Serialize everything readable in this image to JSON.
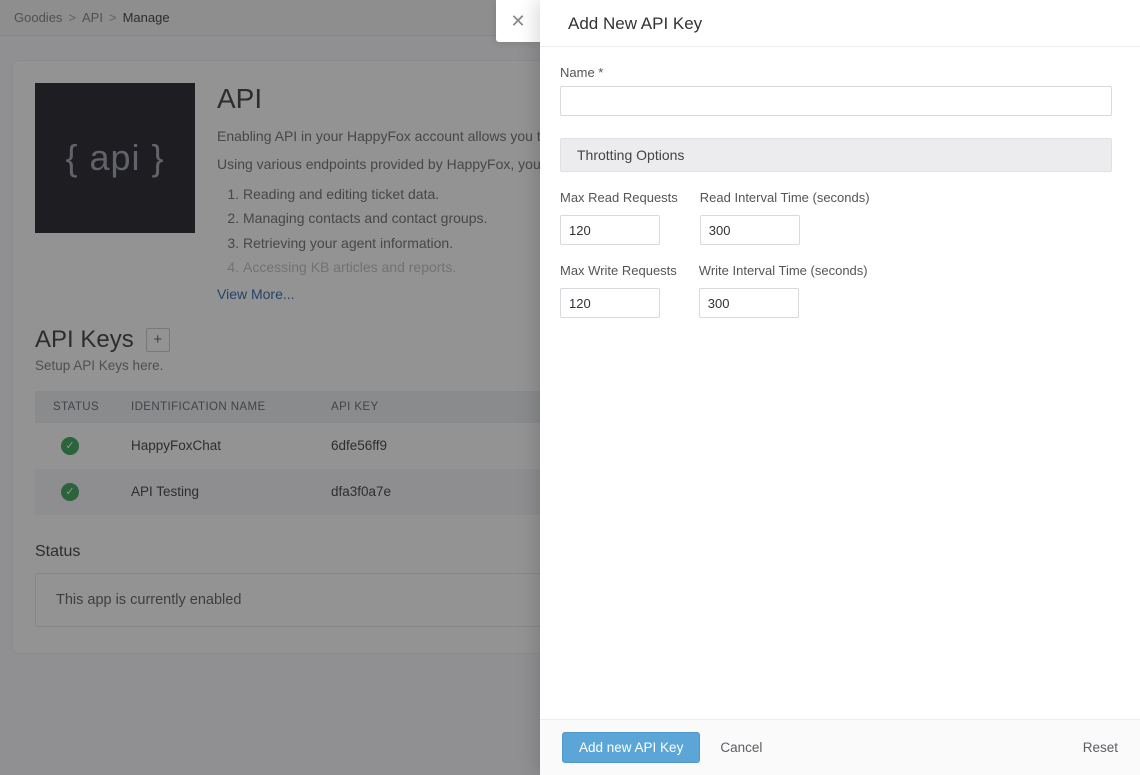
{
  "breadcrumb": {
    "root": "Goodies",
    "mid": "API",
    "current": "Manage"
  },
  "api_badge": "{ api }",
  "api": {
    "title": "API",
    "p1": "Enabling API in your HappyFox account allows you to use endpoints exposed by HappyFox.",
    "p2": "Using various endpoints provided by HappyFox, you can:",
    "items": [
      "Reading and editing ticket data.",
      "Managing contacts and contact groups.",
      "Retrieving your agent information.",
      "Accessing KB articles and reports."
    ],
    "view_more": "View More..."
  },
  "keys": {
    "heading": "API Keys",
    "plus": "+",
    "subtext": "Setup API Keys here.",
    "cols": {
      "status": "STATUS",
      "name": "IDENTIFICATION NAME",
      "key": "API KEY"
    },
    "rows": [
      {
        "name": "HappyFoxChat",
        "key": "6dfe56ff9"
      },
      {
        "name": "API Testing",
        "key": "dfa3f0a7e"
      }
    ]
  },
  "status": {
    "heading": "Status",
    "text": "This app is currently enabled"
  },
  "panel": {
    "title": "Add New API Key",
    "name_label": "Name *",
    "throttle_section": "Throtting Options",
    "max_read_label": "Max Read Requests",
    "max_read_value": "120",
    "read_interval_label": "Read Interval Time (seconds)",
    "read_interval_value": "300",
    "max_write_label": "Max Write Requests",
    "max_write_value": "120",
    "write_interval_label": "Write Interval Time (seconds)",
    "write_interval_value": "300",
    "submit": "Add new API Key",
    "cancel": "Cancel",
    "reset": "Reset",
    "close_glyph": "✕"
  }
}
